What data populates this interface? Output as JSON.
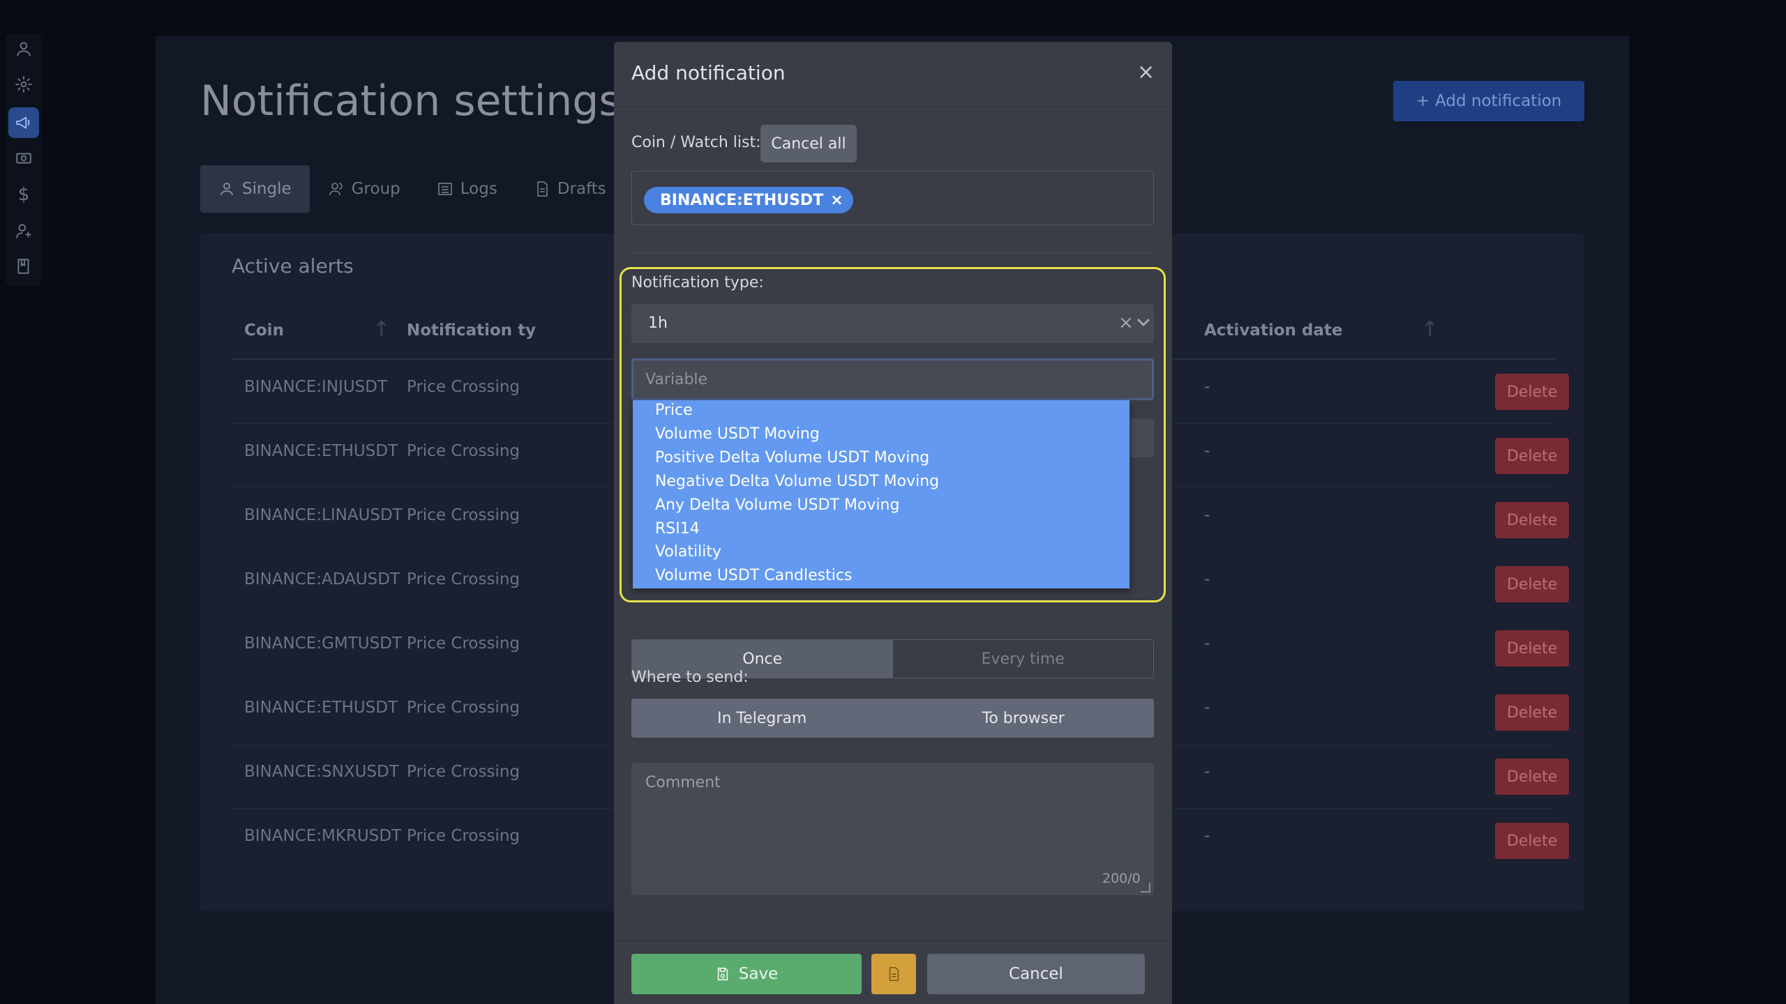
{
  "page": {
    "title": "Notification settings",
    "add_button": "Add notification"
  },
  "tabs": [
    {
      "label": "Single"
    },
    {
      "label": "Group"
    },
    {
      "label": "Logs"
    },
    {
      "label": "Drafts"
    }
  ],
  "alerts": {
    "title": "Active alerts",
    "columns": {
      "coin": "Coin",
      "type": "Notification ty",
      "activation": "Activation date"
    },
    "delete_label": "Delete",
    "rows": [
      {
        "coin": "BINANCE:INJUSDT",
        "type": "Price Crossing",
        "activation": "-"
      },
      {
        "coin": "BINANCE:ETHUSDT",
        "type": "Price Crossing",
        "activation": "-"
      },
      {
        "coin": "BINANCE:LINAUSDT",
        "type": "Price Crossing",
        "activation": "-"
      },
      {
        "coin": "BINANCE:ADAUSDT",
        "type": "Price Crossing",
        "activation": "-"
      },
      {
        "coin": "BINANCE:GMTUSDT",
        "type": "Price Crossing",
        "activation": "-"
      },
      {
        "coin": "BINANCE:ETHUSDT",
        "type": "Price Crossing",
        "activation": "-"
      },
      {
        "coin": "BINANCE:SNXUSDT",
        "type": "Price Crossing",
        "activation": "-"
      },
      {
        "coin": "BINANCE:MKRUSDT",
        "type": "Price Crossing",
        "activation": "-"
      }
    ]
  },
  "modal": {
    "title": "Add notification",
    "close": "×",
    "coin_label": "Coin / Watch list:",
    "cancel_all": "Cancel all",
    "chip": "BINANCE:ETHUSDT",
    "chip_remove": "×",
    "type_label": "Notification type:",
    "type_value": "1h",
    "clear_glyph": "×",
    "variable_placeholder": "Variable",
    "dropdown_options": [
      "Price",
      "Volume USDT Moving",
      "Positive Delta Volume USDT Moving",
      "Negative Delta Volume USDT Moving",
      "Any Delta Volume USDT Moving",
      "RSI14",
      "Volatility",
      "Volume USDT Candlestics"
    ],
    "frequency": {
      "once": "Once",
      "every_time": "Every time"
    },
    "where_label": "Where to send:",
    "send": {
      "telegram": "In Telegram",
      "browser": "To browser"
    },
    "comment_placeholder": "Comment",
    "comment_counter": "200/0",
    "save": "Save",
    "cancel": "Cancel"
  },
  "colors": {
    "accent": "#4a82e0",
    "dropdown": "#6399f0",
    "highlight": "#e6e24a",
    "save": "#5aac6e",
    "draft": "#d4a03c",
    "delete": "#7a2a32"
  }
}
